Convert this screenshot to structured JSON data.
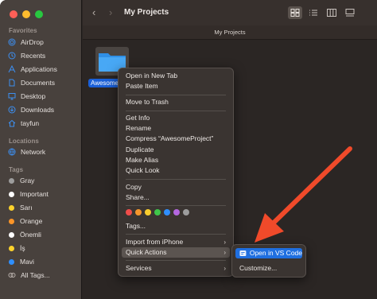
{
  "colors": {
    "sidebar_accent": "#3d8ff0",
    "selection": "#1f6fe0",
    "arrow": "#f04a2a"
  },
  "sidebar": {
    "favorites_heading": "Favorites",
    "favorites": [
      {
        "label": "AirDrop",
        "icon": "airdrop-icon"
      },
      {
        "label": "Recents",
        "icon": "clock-icon"
      },
      {
        "label": "Applications",
        "icon": "applications-icon"
      },
      {
        "label": "Documents",
        "icon": "document-icon"
      },
      {
        "label": "Desktop",
        "icon": "desktop-icon"
      },
      {
        "label": "Downloads",
        "icon": "download-icon"
      },
      {
        "label": "tayfun",
        "icon": "home-icon"
      }
    ],
    "locations_heading": "Locations",
    "locations": [
      {
        "label": "Network",
        "icon": "globe-icon"
      }
    ],
    "tags_heading": "Tags",
    "tags": [
      {
        "label": "Gray",
        "color": "#9d9d9d"
      },
      {
        "label": "Important",
        "color": "#ffffff"
      },
      {
        "label": "Sarı",
        "color": "#fcd22c"
      },
      {
        "label": "Orange",
        "color": "#fc9528"
      },
      {
        "label": "Önemli",
        "color": "#ffffff"
      },
      {
        "label": "İş",
        "color": "#fcd22c"
      },
      {
        "label": "Mavi",
        "color": "#2f8fff"
      },
      {
        "label": "All Tags...",
        "color": "",
        "icon": "all-tags-icon"
      }
    ]
  },
  "toolbar": {
    "back_icon": "chevron-left-icon",
    "forward_icon": "chevron-right-icon",
    "title": "My Projects",
    "view_buttons": [
      "icon-view",
      "list-view",
      "column-view",
      "gallery-view"
    ]
  },
  "pathbar": {
    "title": "My Projects"
  },
  "content": {
    "folder_label": "AwesomeP"
  },
  "context_menu": {
    "items": [
      {
        "label": "Open in New Tab"
      },
      {
        "label": "Paste Item"
      },
      {
        "label": "Move to Trash"
      },
      {
        "label": "Get Info"
      },
      {
        "label": "Rename"
      },
      {
        "label": "Compress “AwesomeProject”"
      },
      {
        "label": "Duplicate"
      },
      {
        "label": "Make Alias"
      },
      {
        "label": "Quick Look"
      },
      {
        "label": "Copy"
      },
      {
        "label": "Share..."
      },
      {
        "label": "Tags..."
      },
      {
        "label": "Import from iPhone"
      },
      {
        "label": "Quick Actions"
      },
      {
        "label": "Services"
      }
    ],
    "tag_colors": [
      "#f04d4a",
      "#f5962c",
      "#f7cc2e",
      "#3fc64a",
      "#2f8fff",
      "#b467e0",
      "#9d9d9d"
    ]
  },
  "submenu": {
    "items": [
      {
        "label": "Open in VS Code"
      },
      {
        "label": "Customize..."
      }
    ]
  }
}
